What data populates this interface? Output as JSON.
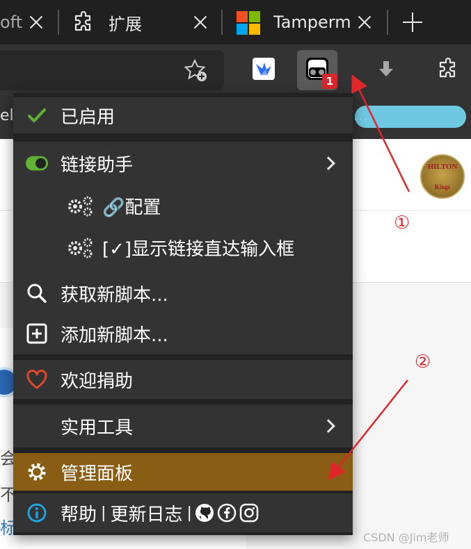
{
  "browser": {
    "tabs": [
      {
        "label": "oft",
        "close_icon": "close-icon"
      },
      {
        "label": "扩展",
        "icon": "puzzle-icon",
        "close_icon": "close-icon"
      },
      {
        "label": "Tampermo",
        "icon": "microsoft-logo-icon",
        "close_icon": "close-icon"
      }
    ],
    "new_tab_icon": "plus-icon",
    "toolbar": {
      "favorite_icon": "star-add-icon",
      "extensions": [
        "bird-extension-icon",
        "tampermonkey-icon",
        "download-arrow-icon",
        "puzzle-icon"
      ],
      "tampermonkey_badge": "1"
    },
    "bookmarks": {
      "left_fragment": "el",
      "right_fragment": "..."
    }
  },
  "page": {
    "avatar_text": "HILTON",
    "avatar_subtext": "Kings",
    "text_fragments": [
      "会",
      "不",
      "标"
    ]
  },
  "menu": {
    "enabled": "已启用",
    "link_helper": "链接助手",
    "config": "🔗配置",
    "show_input": "[✓]显示链接直达输入框",
    "get_new": "获取新脚本...",
    "add_new": "添加新脚本...",
    "donate": "欢迎捐助",
    "utilities": "实用工具",
    "dashboard": "管理面板",
    "help": "帮助",
    "changelog": "更新日志",
    "separator": "|"
  },
  "annotations": {
    "marker_1": "①",
    "marker_2": "②"
  },
  "watermark": "CSDN @Jim老师",
  "colors": {
    "menu_bg": "#333333",
    "highlight": "#8a5d15",
    "check_green": "#5fb233",
    "heart_red": "#e0472b",
    "info_blue": "#1fa2e0",
    "annotation_red": "#e0262a"
  }
}
